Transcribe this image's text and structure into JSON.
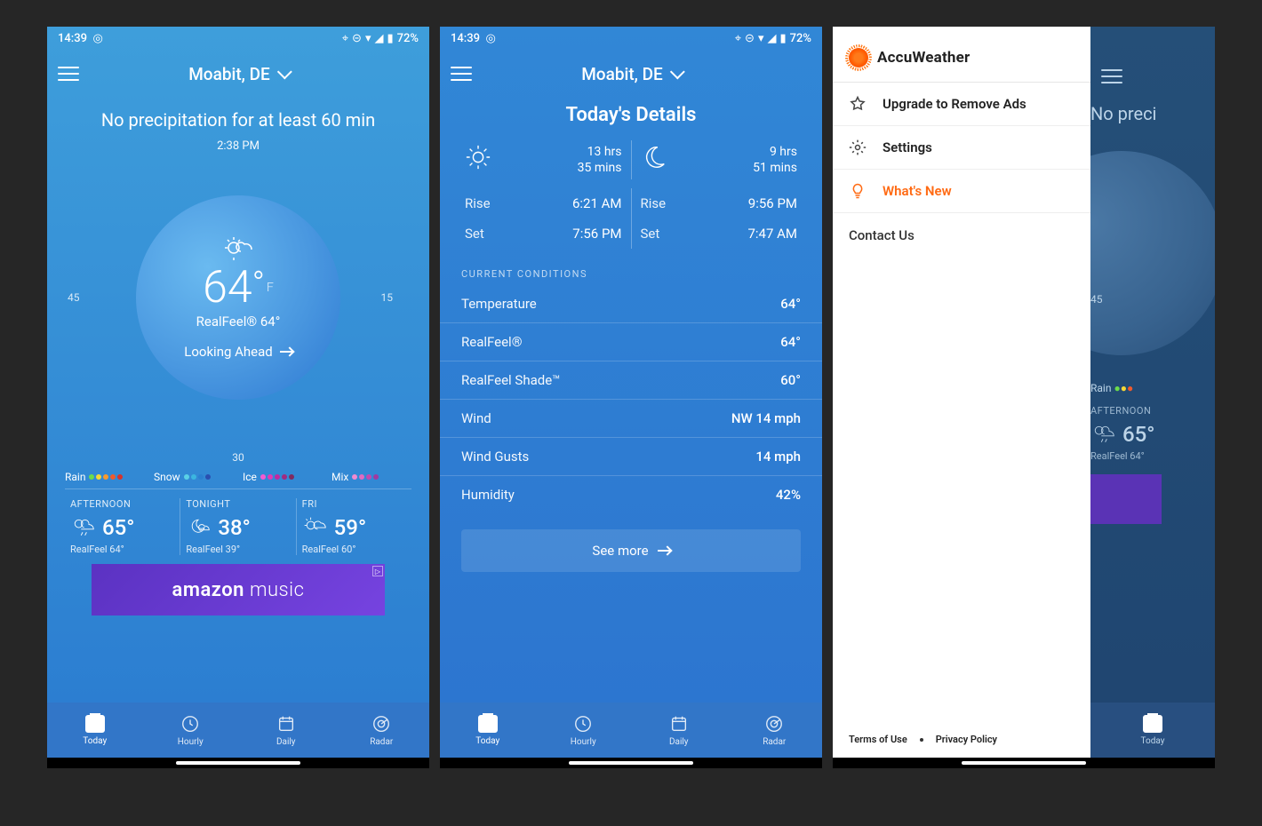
{
  "status": {
    "time": "14:39",
    "battery_pct": "72%"
  },
  "screen1": {
    "location": "Moabit, DE",
    "precip_msg": "No precipitation for at least 60 min",
    "timestamp": "2:38 PM",
    "tick_left": "45",
    "tick_right": "15",
    "tick_bottom": "30",
    "temp": "64",
    "temp_unit": "F",
    "realfeel": "RealFeel® 64°",
    "look_ahead": "Looking Ahead",
    "legends": {
      "rain": "Rain",
      "snow": "Snow",
      "ice": "Ice",
      "mix": "Mix"
    },
    "forecast": [
      {
        "label": "AFTERNOON",
        "temp": "65°",
        "realfeel": "RealFeel 64°",
        "icon": "sun-cloud-rain"
      },
      {
        "label": "TONIGHT",
        "temp": "38°",
        "realfeel": "RealFeel 39°",
        "icon": "moon-cloud"
      },
      {
        "label": "FRI",
        "temp": "59°",
        "realfeel": "RealFeel 60°",
        "icon": "sun-cloud"
      }
    ],
    "ad_text1": "amazon",
    "ad_text2": "music"
  },
  "screen2": {
    "location": "Moabit, DE",
    "title": "Today's Details",
    "sun": {
      "duration_h": "13 hrs",
      "duration_m": "35 mins",
      "rise_lab": "Rise",
      "rise": "6:21 AM",
      "set_lab": "Set",
      "set": "7:56 PM"
    },
    "moon": {
      "duration_h": "9 hrs",
      "duration_m": "51 mins",
      "rise_lab": "Rise",
      "rise": "9:56 PM",
      "set_lab": "Set",
      "set": "7:47 AM"
    },
    "section_header": "CURRENT CONDITIONS",
    "conditions": [
      {
        "label": "Temperature",
        "value": "64°"
      },
      {
        "label": "RealFeel®",
        "value": "64°"
      },
      {
        "label": "RealFeel Shade™",
        "value": "60°"
      },
      {
        "label": "Wind",
        "value": "NW 14 mph"
      },
      {
        "label": "Wind Gusts",
        "value": "14 mph"
      },
      {
        "label": "Humidity",
        "value": "42%"
      }
    ],
    "see_more": "See more"
  },
  "screen3": {
    "brand": "AccuWeather",
    "items": {
      "upgrade": "Upgrade to Remove Ads",
      "settings": "Settings",
      "whats_new": "What's New"
    },
    "contact": "Contact Us",
    "footer": {
      "terms": "Terms of Use",
      "privacy": "Privacy Policy"
    },
    "peek": {
      "precip_msg": "No preci",
      "tick_left": "45",
      "rain": "Rain",
      "fc_label": "AFTERNOON",
      "fc_temp": "65°",
      "fc_realfeel": "RealFeel 64°"
    }
  },
  "tabs": {
    "today": "Today",
    "hourly": "Hourly",
    "daily": "Daily",
    "radar": "Radar"
  }
}
